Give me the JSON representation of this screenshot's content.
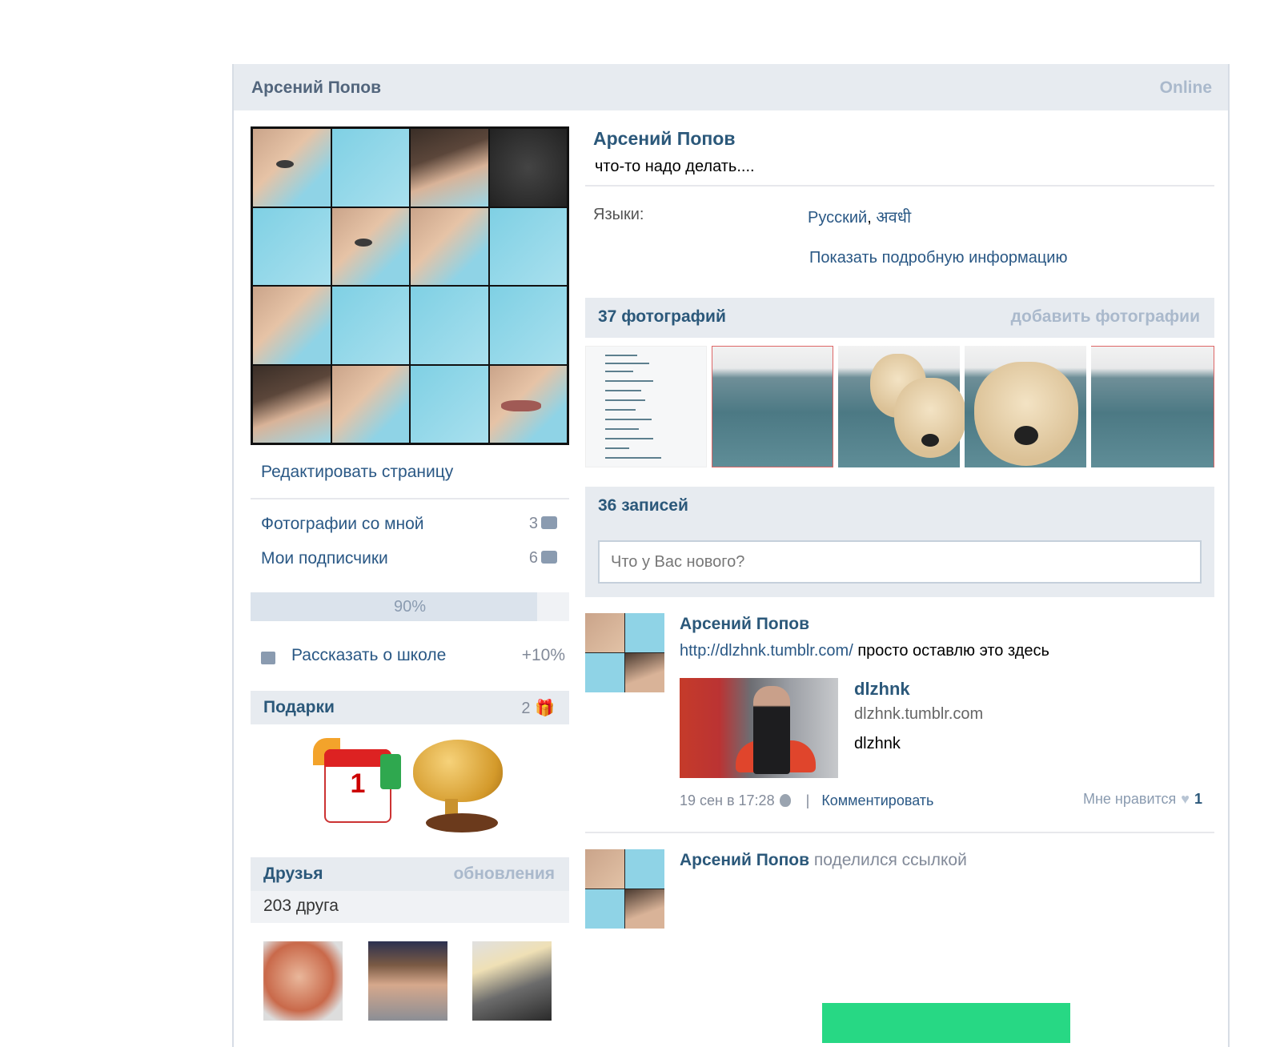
{
  "header": {
    "name": "Арсений Попов",
    "status": "Online"
  },
  "left": {
    "edit_page": "Редактировать страницу",
    "menu": [
      {
        "label": "Фотографии со мной",
        "count": "3",
        "icon": "camera-icon"
      },
      {
        "label": "Мои подписчики",
        "count": "6",
        "icon": "people-icon"
      }
    ],
    "progress": {
      "label": "90%",
      "value": 0.9
    },
    "school": {
      "label": "Рассказать о школе",
      "bonus": "+10%"
    },
    "gifts": {
      "title": "Подарки",
      "count": "2",
      "items": [
        {
          "name": "calendar-gift",
          "text": "1"
        },
        {
          "name": "brain-gift"
        }
      ]
    },
    "friends": {
      "title": "Друзья",
      "updates": "обновления",
      "count_text": "203 друга"
    }
  },
  "profile": {
    "name": "Арсений Попов",
    "status_text": "что-то надо делать....",
    "languages_label": "Языки:",
    "languages_first": "Русский",
    "languages_sep": ", ",
    "languages_second": "अवधी",
    "more_info": "Показать подробную информацию"
  },
  "photos": {
    "title": "37 фотографий",
    "add": "добавить фотографии"
  },
  "posts": {
    "title": "36 записей",
    "input_placeholder": "Что у Вас нового?",
    "items": [
      {
        "author": "Арсений Попов",
        "link": "http://dlzhnk.tumblr.com/",
        "text": " просто оставлю это здесь",
        "attachment": {
          "title": "dlzhnk",
          "domain": "dlzhnk.tumblr.com",
          "description": "dlzhnk"
        },
        "date": "19 сен в 17:28",
        "separator": "|",
        "comment": "Комментировать",
        "like_label": "Мне нравится",
        "like_count": "1"
      },
      {
        "author": "Арсений Попов",
        "action": " поделился ссылкой"
      }
    ]
  },
  "colors": {
    "accent": "#2b587a",
    "link": "#2a5885",
    "header_bg": "#e7ebf0",
    "green": "#27d884"
  }
}
